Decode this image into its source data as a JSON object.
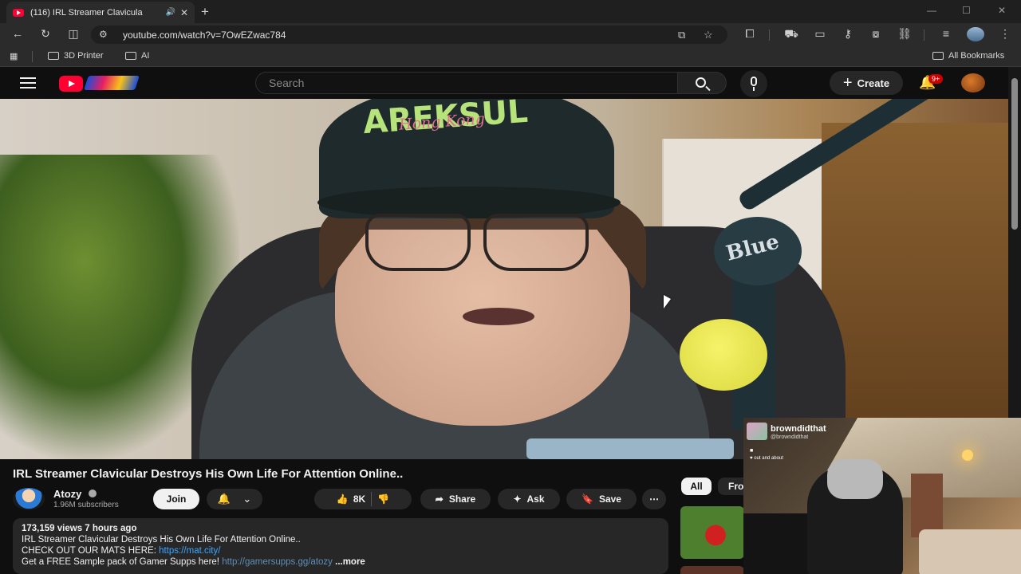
{
  "browser": {
    "tab_title": "(116) IRL Streamer Clavicula",
    "new_tab": "+",
    "url": "youtube.com/watch?v=7OwEZwac784",
    "bookmarks": [
      {
        "label": "3D Printer"
      },
      {
        "label": "AI"
      }
    ],
    "all_bookmarks": "All Bookmarks"
  },
  "masthead": {
    "search_placeholder": "Search",
    "create_label": "Create",
    "notification_count": "9+"
  },
  "video": {
    "cap_text_main": "AREKSUL",
    "cap_text_sub": "Hong Kong",
    "mic_brand": "Blue",
    "title": "IRL Streamer Clavicular Destroys His Own Life For Attention Online.."
  },
  "channel": {
    "name": "Atozy",
    "subscribers": "1.96M subscribers",
    "join_label": "Join"
  },
  "actions": {
    "likes": "8K",
    "share": "Share",
    "ask": "Ask",
    "save": "Save"
  },
  "description": {
    "meta": "173,159 views  7 hours ago",
    "line1": "IRL Streamer Clavicular Destroys His Own Life For Attention Online..",
    "line2_prefix": "CHECK OUT OUR MATS HERE: ",
    "line2_link": "https://mat.city/",
    "line3_prefix": "Get a FREE Sample pack of Gamer Supps here! ",
    "line3_link": "http://gamersupps.gg/atozy",
    "more": "...more"
  },
  "chips": {
    "all": "All",
    "from": "From"
  },
  "webcam": {
    "name": "browndidthat",
    "handle": "@browndidthat",
    "line1": "■",
    "line2": "♥ out and about"
  },
  "colors": {
    "yt_red": "#ff0033",
    "link_blue": "#3ea6ff",
    "badge_red": "#cc0000"
  }
}
